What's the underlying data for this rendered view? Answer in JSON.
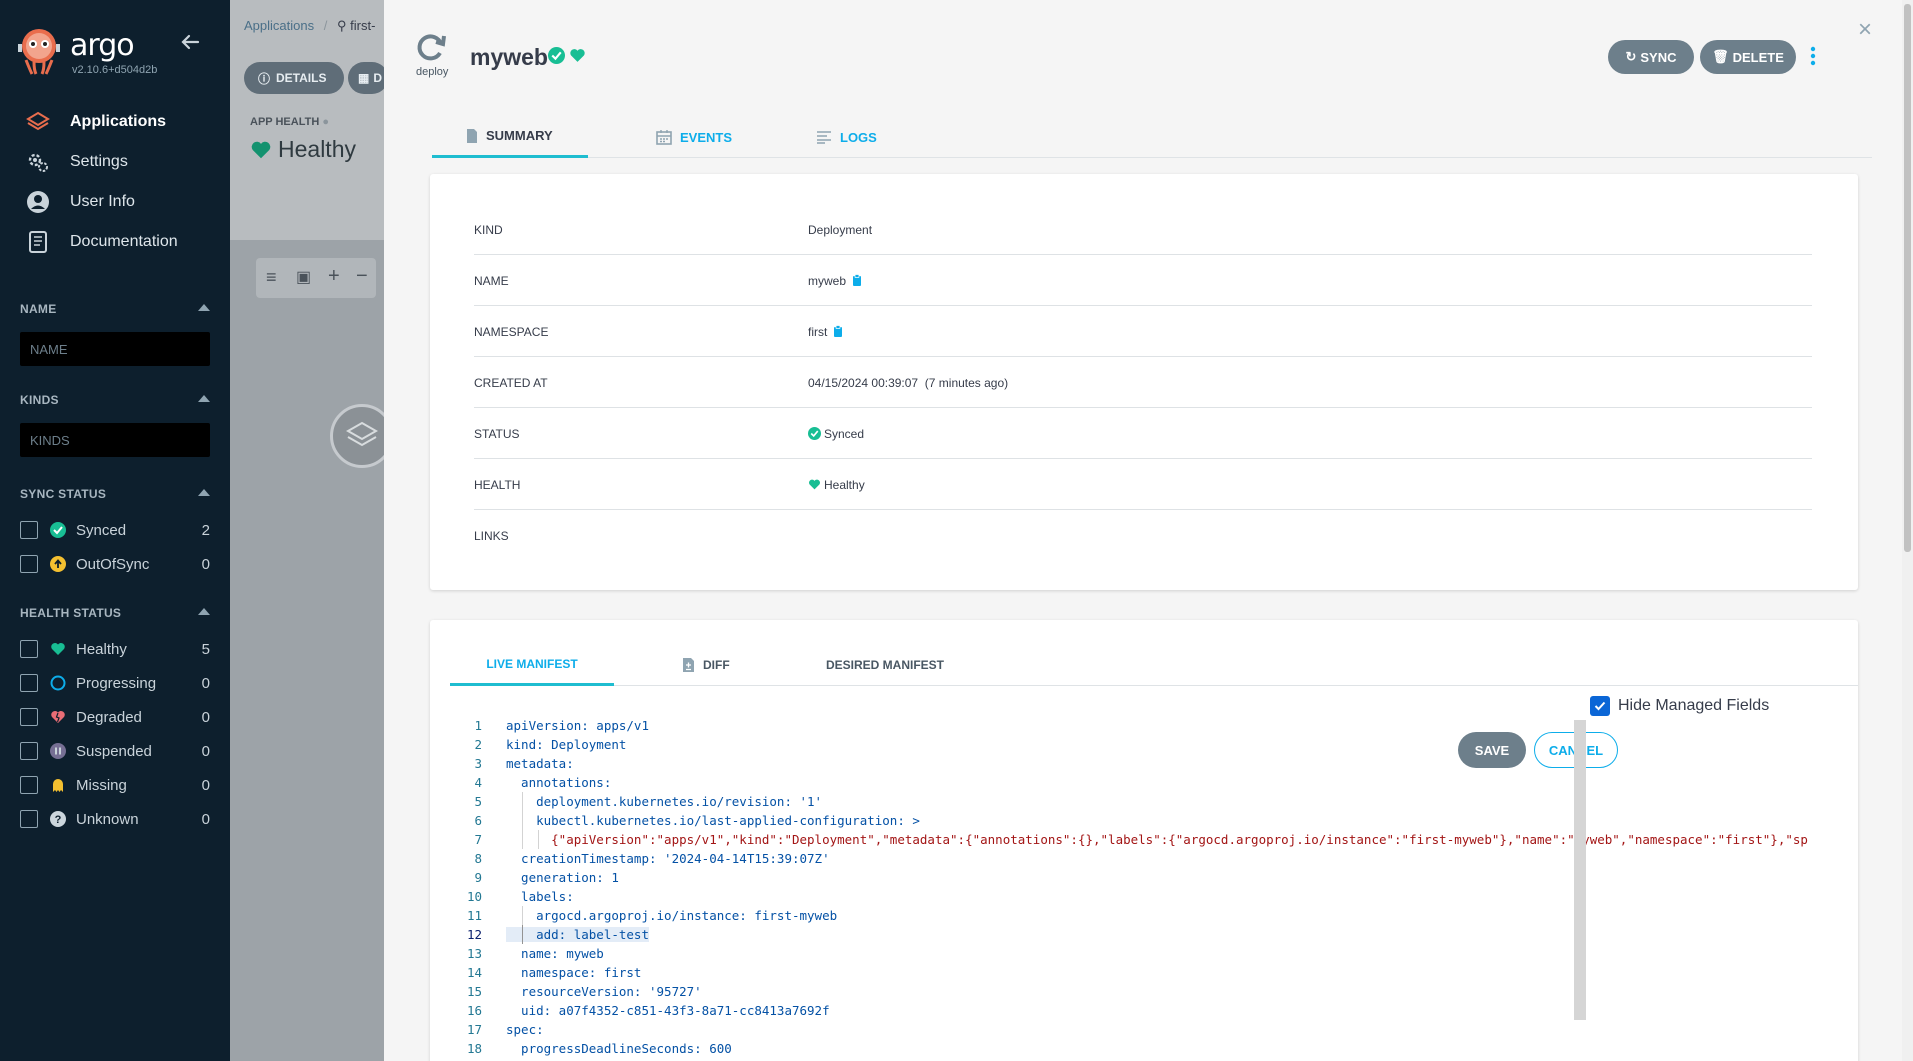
{
  "sidebar": {
    "logo_text": "argo",
    "version": "v2.10.6+d504d2b",
    "nav": [
      {
        "label": "Applications",
        "icon": "layers-icon"
      },
      {
        "label": "Settings",
        "icon": "gears-icon"
      },
      {
        "label": "User Info",
        "icon": "user-icon"
      },
      {
        "label": "Documentation",
        "icon": "book-icon"
      }
    ],
    "filters": {
      "name_title": "NAME",
      "name_placeholder": "NAME",
      "kinds_title": "KINDS",
      "kinds_placeholder": "KINDS",
      "sync_title": "SYNC STATUS",
      "sync": [
        {
          "label": "Synced",
          "count": "2",
          "color": "#18be94"
        },
        {
          "label": "OutOfSync",
          "count": "0",
          "color": "#f4c030"
        }
      ],
      "health_title": "HEALTH STATUS",
      "health": [
        {
          "label": "Healthy",
          "count": "5",
          "color": "#18be94"
        },
        {
          "label": "Progressing",
          "count": "0",
          "color": "#0dadea"
        },
        {
          "label": "Degraded",
          "count": "0",
          "color": "#e96d76"
        },
        {
          "label": "Suspended",
          "count": "0",
          "color": "#766f94"
        },
        {
          "label": "Missing",
          "count": "0",
          "color": "#f4c030"
        },
        {
          "label": "Unknown",
          "count": "0",
          "color": "#ccd6dd"
        }
      ]
    }
  },
  "background": {
    "breadcrumb_app": "Applications",
    "breadcrumb_sep": "/",
    "breadcrumb_search": "first-",
    "details_btn": "DETAILS",
    "diff_btn_partial": "D",
    "app_health_label": "APP HEALTH",
    "app_health_value": "Healthy"
  },
  "panel": {
    "kind_short": "deploy",
    "name": "myweb",
    "sync_btn": "SYNC",
    "delete_btn": "DELETE",
    "close": "×",
    "tabs": [
      {
        "label": "SUMMARY"
      },
      {
        "label": "EVENTS"
      },
      {
        "label": "LOGS"
      }
    ],
    "summary": [
      {
        "key": "KIND",
        "value": "Deployment"
      },
      {
        "key": "NAME",
        "value": "myweb"
      },
      {
        "key": "NAMESPACE",
        "value": "first"
      },
      {
        "key": "CREATED AT",
        "value": "04/15/2024 00:39:07  (7 minutes ago)"
      },
      {
        "key": "STATUS",
        "value": "Synced"
      },
      {
        "key": "HEALTH",
        "value": "Healthy"
      },
      {
        "key": "LINKS",
        "value": ""
      }
    ],
    "manifest_tabs": [
      {
        "label": "LIVE MANIFEST"
      },
      {
        "label": "DIFF"
      },
      {
        "label": "DESIRED MANIFEST"
      }
    ],
    "hide_managed_label": "Hide Managed Fields",
    "hide_managed_checked": true,
    "save_btn": "SAVE",
    "cancel_btn": "CANCEL",
    "editor_current_line": 12,
    "editor_lines": [
      {
        "n": "1",
        "t": "apiVersion: apps/v1"
      },
      {
        "n": "2",
        "t": "kind: Deployment"
      },
      {
        "n": "3",
        "t": "metadata:"
      },
      {
        "n": "4",
        "t": "  annotations:"
      },
      {
        "n": "5",
        "t": "    deployment.kubernetes.io/revision: '1'"
      },
      {
        "n": "6",
        "t": "    kubectl.kubernetes.io/last-applied-configuration: >"
      },
      {
        "n": "7",
        "t": "      {\"apiVersion\":\"apps/v1\",\"kind\":\"Deployment\",\"metadata\":{\"annotations\":{},\"labels\":{\"argocd.argoproj.io/instance\":\"first-myweb\"},\"name\":\"myweb\",\"namespace\":\"first\"},\"sp"
      },
      {
        "n": "8",
        "t": "  creationTimestamp: '2024-04-14T15:39:07Z'"
      },
      {
        "n": "9",
        "t": "  generation: 1"
      },
      {
        "n": "10",
        "t": "  labels:"
      },
      {
        "n": "11",
        "t": "    argocd.argoproj.io/instance: first-myweb"
      },
      {
        "n": "12",
        "t": "    add: label-test"
      },
      {
        "n": "13",
        "t": "  name: myweb"
      },
      {
        "n": "14",
        "t": "  namespace: first"
      },
      {
        "n": "15",
        "t": "  resourceVersion: '95727'"
      },
      {
        "n": "16",
        "t": "  uid: a07f4352-c851-43f3-8a71-cc8413a7692f"
      },
      {
        "n": "17",
        "t": "spec:"
      },
      {
        "n": "18",
        "t": "  progressDeadlineSeconds: 600"
      }
    ]
  },
  "colors": {
    "sidebar_bg": "#0d1f2d",
    "accent": "#0dadea",
    "teal": "#18be94",
    "button_gray": "#6d7f8b"
  }
}
